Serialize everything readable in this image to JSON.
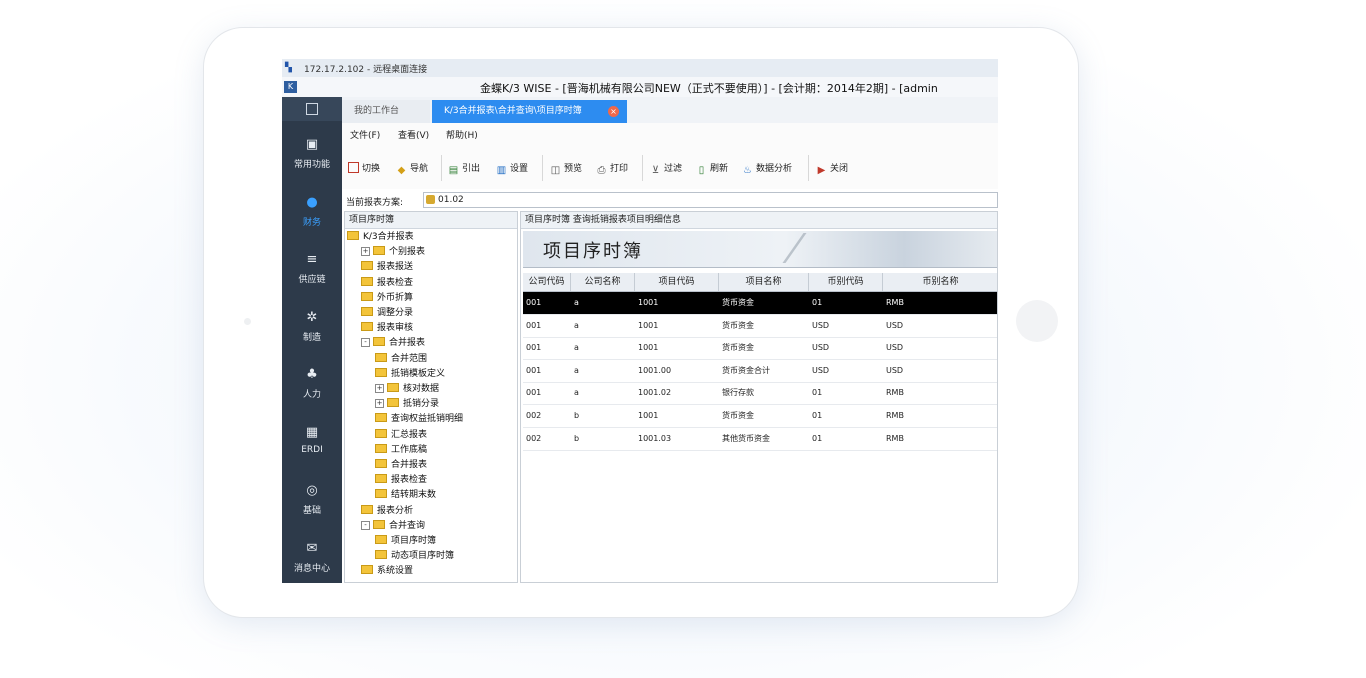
{
  "rdp": {
    "title": "172.17.2.102 - 远程桌面连接"
  },
  "app": {
    "title": "金蝶K/3 WISE - [晋海机械有限公司NEW（正式不要使用）] - [会计期：2014年2期] - [admin"
  },
  "sidebar": {
    "items": [
      {
        "label": "常用功能",
        "icon": "home-icon"
      },
      {
        "label": "财务",
        "icon": "dollar-icon",
        "active": true
      },
      {
        "label": "供应链",
        "icon": "database-icon"
      },
      {
        "label": "制造",
        "icon": "gear-icon"
      },
      {
        "label": "人力",
        "icon": "org-chart-icon"
      },
      {
        "label": "ERDI",
        "icon": "grid-icon"
      },
      {
        "label": "基础",
        "icon": "settings-icon"
      },
      {
        "label": "消息中心",
        "icon": "mail-icon"
      }
    ]
  },
  "tabs": [
    {
      "label": "我的工作台"
    },
    {
      "label": "K/3合并报表\\合并查询\\项目序时簿",
      "active": true
    }
  ],
  "menu": [
    "文件(F)",
    "查看(V)",
    "帮助(H)"
  ],
  "toolbar": [
    {
      "label": "切换",
      "icon": "switch-icon",
      "color": "#c0392b"
    },
    {
      "label": "导航",
      "icon": "navigate-icon",
      "color": "#d4a017"
    },
    {
      "label": "引出",
      "icon": "export-icon",
      "color": "#2e7d32"
    },
    {
      "label": "设置",
      "icon": "settings-book-icon",
      "color": "#1565c0"
    },
    {
      "label": "预览",
      "icon": "preview-icon",
      "color": "#555555"
    },
    {
      "label": "打印",
      "icon": "print-icon",
      "color": "#555555"
    },
    {
      "label": "过滤",
      "icon": "filter-icon",
      "color": "#555555"
    },
    {
      "label": "刷新",
      "icon": "refresh-icon",
      "color": "#2e7d32"
    },
    {
      "label": "数据分析",
      "icon": "analysis-icon",
      "color": "#1565c0"
    },
    {
      "label": "关闭",
      "icon": "close-door-icon",
      "color": "#c0392b"
    }
  ],
  "scheme": {
    "label": "当前报表方案:",
    "value": "01.02"
  },
  "tree": {
    "header": "项目序时簿",
    "rows": [
      {
        "label": "K/3合并报表",
        "level": 0,
        "expander": ""
      },
      {
        "label": "个别报表",
        "level": 1,
        "expander": "+"
      },
      {
        "label": "报表报送",
        "level": 1,
        "expander": ""
      },
      {
        "label": "报表检查",
        "level": 1,
        "expander": ""
      },
      {
        "label": "外币折算",
        "level": 1,
        "expander": ""
      },
      {
        "label": "调整分录",
        "level": 1,
        "expander": ""
      },
      {
        "label": "报表审核",
        "level": 1,
        "expander": ""
      },
      {
        "label": "合并报表",
        "level": 1,
        "expander": "-"
      },
      {
        "label": "合并范围",
        "level": 2,
        "expander": ""
      },
      {
        "label": "抵销模板定义",
        "level": 2,
        "expander": ""
      },
      {
        "label": "核对数据",
        "level": 2,
        "expander": "+"
      },
      {
        "label": "抵销分录",
        "level": 2,
        "expander": "+"
      },
      {
        "label": "查询权益抵销明细",
        "level": 2,
        "expander": ""
      },
      {
        "label": "汇总报表",
        "level": 2,
        "expander": ""
      },
      {
        "label": "工作底稿",
        "level": 2,
        "expander": ""
      },
      {
        "label": "合并报表",
        "level": 2,
        "expander": ""
      },
      {
        "label": "报表检查",
        "level": 2,
        "expander": ""
      },
      {
        "label": "结转期末数",
        "level": 2,
        "expander": ""
      },
      {
        "label": "报表分析",
        "level": 1,
        "expander": ""
      },
      {
        "label": "合并查询",
        "level": 1,
        "expander": "-"
      },
      {
        "label": "项目序时簿",
        "level": 2,
        "expander": ""
      },
      {
        "label": "动态项目序时簿",
        "level": 2,
        "expander": ""
      },
      {
        "label": "系统设置",
        "level": 1,
        "expander": ""
      }
    ]
  },
  "report": {
    "header": "项目序时簿 查询抵销报表项目明细信息",
    "banner_title": "项目序时簿",
    "columns": [
      "公司代码",
      "公司名称",
      "项目代码",
      "项目名称",
      "币别代码",
      "币别名称"
    ],
    "rows": [
      [
        "001",
        "a",
        "1001",
        "货币资金",
        "01",
        "RMB"
      ],
      [
        "001",
        "a",
        "1001",
        "货币资金",
        "USD",
        "USD"
      ],
      [
        "001",
        "a",
        "1001",
        "货币资金",
        "USD",
        "USD"
      ],
      [
        "001",
        "a",
        "1001.00",
        "货币资金合计",
        "USD",
        "USD"
      ],
      [
        "001",
        "a",
        "1001.02",
        "银行存款",
        "01",
        "RMB"
      ],
      [
        "002",
        "b",
        "1001",
        "货币资金",
        "01",
        "RMB"
      ],
      [
        "002",
        "b",
        "1001.03",
        "其他货币资金",
        "01",
        "RMB"
      ]
    ],
    "selected_row": 0
  }
}
